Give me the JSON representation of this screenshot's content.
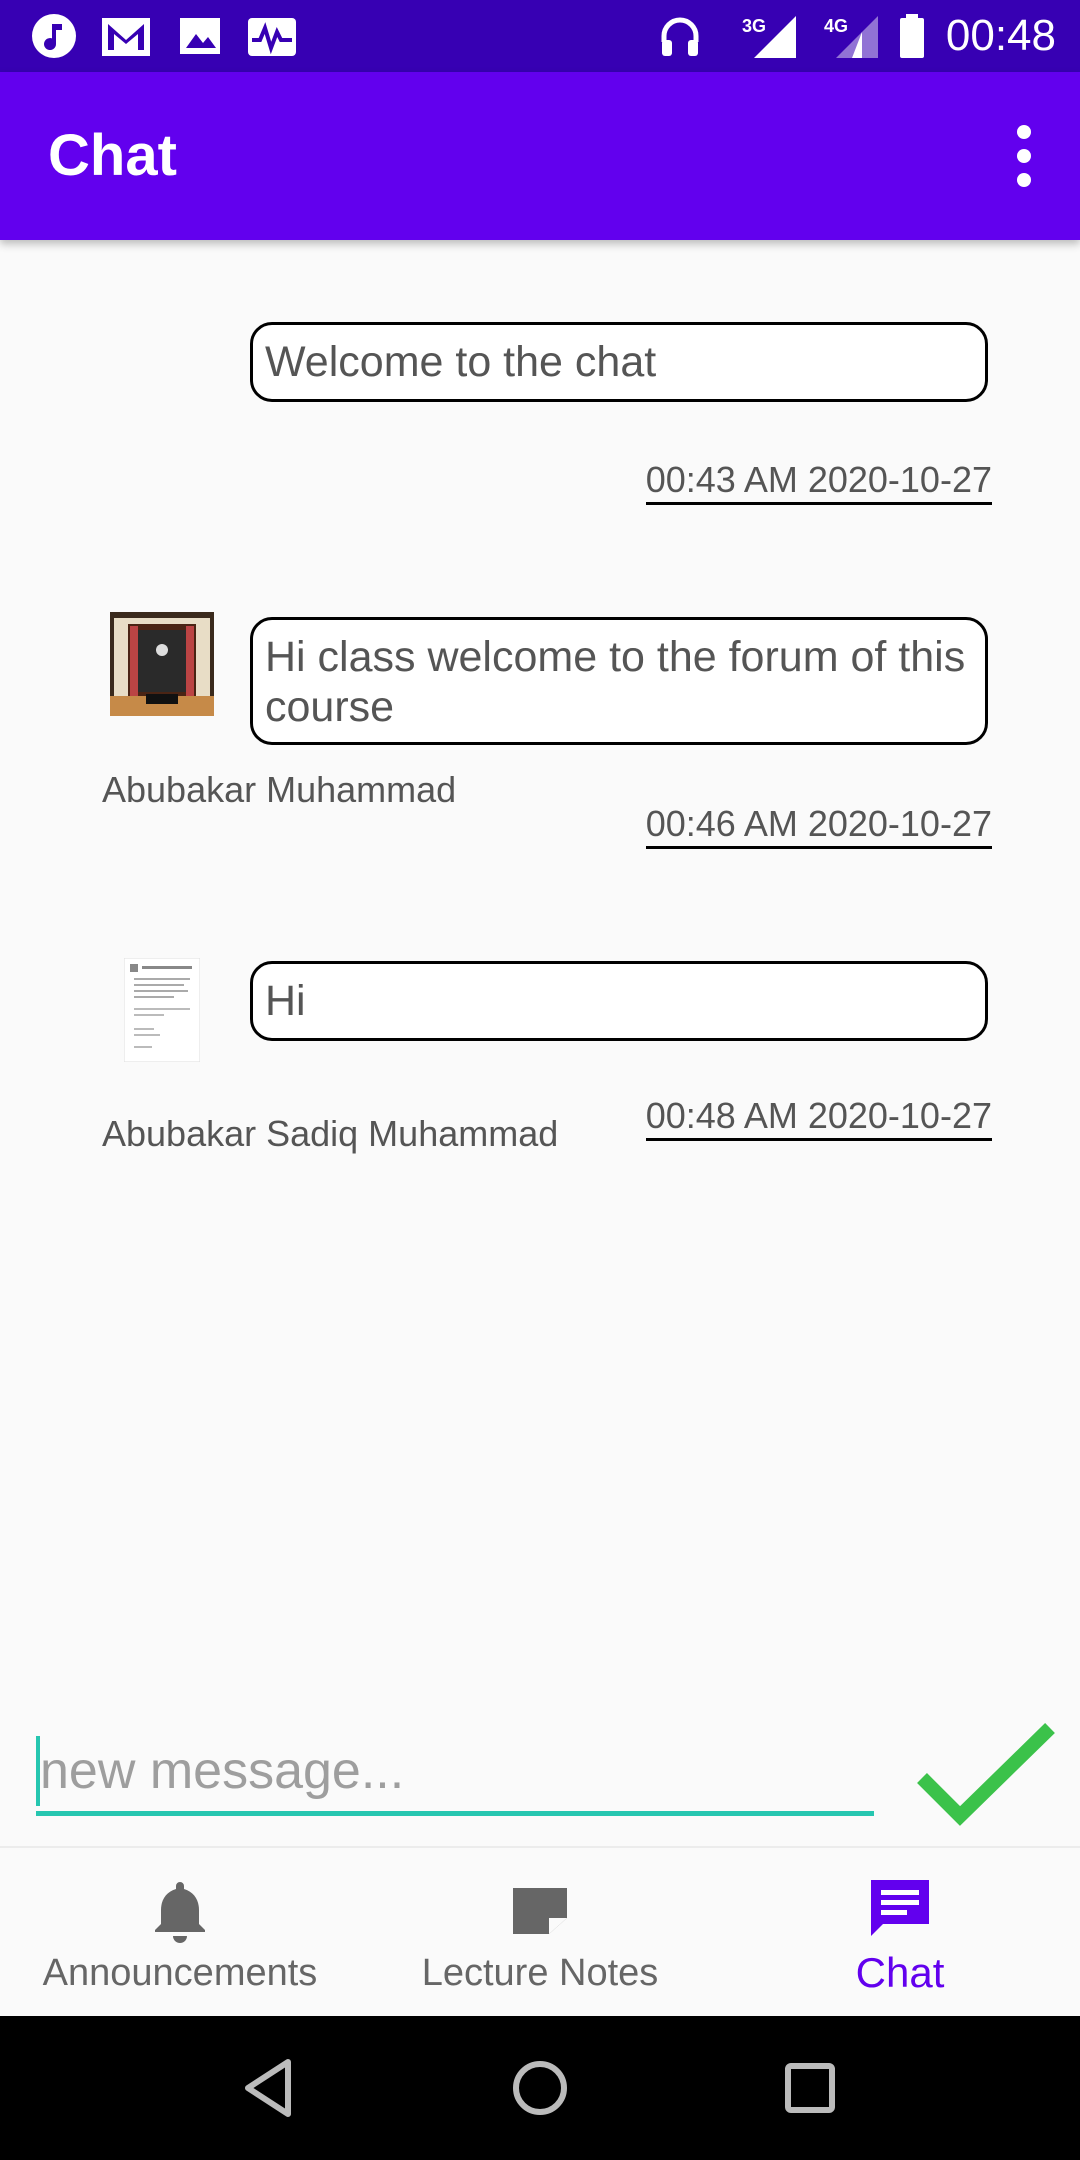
{
  "status_bar": {
    "time": "00:48",
    "left_icons": [
      "music-icon",
      "gmail-icon",
      "gallery-icon",
      "activity-icon"
    ],
    "right_icons": [
      "headphones-icon",
      "signal-3g-icon",
      "signal-4g-icon",
      "battery-icon"
    ]
  },
  "app_bar": {
    "title": "Chat",
    "background": "#6200ee"
  },
  "messages": [
    {
      "text": "Welcome to the chat",
      "timestamp": "00:43 AM 2020-10-27",
      "sender": "",
      "avatar": ""
    },
    {
      "text": "Hi class welcome to the forum of this course",
      "timestamp": "00:46 AM 2020-10-27",
      "sender": "Abubakar Muhammad",
      "avatar": "room-photo-thumbnail"
    },
    {
      "text": "Hi",
      "timestamp": "00:48 AM 2020-10-27",
      "sender": "Abubakar Sadiq Muhammad",
      "avatar": "document-thumbnail"
    }
  ],
  "composer": {
    "placeholder": "new message...",
    "value": "",
    "send_icon": "checkmark-icon",
    "accent": "#26c6b0",
    "send_color": "#3bc24a"
  },
  "bottom_nav": {
    "items": [
      {
        "label": "Announcements",
        "icon": "bell-icon",
        "active": false
      },
      {
        "label": "Lecture Notes",
        "icon": "note-icon",
        "active": false
      },
      {
        "label": "Chat",
        "icon": "chat-icon",
        "active": true
      }
    ],
    "active_color": "#6200ee"
  },
  "system_nav": [
    "back-icon",
    "home-icon",
    "recents-icon"
  ]
}
